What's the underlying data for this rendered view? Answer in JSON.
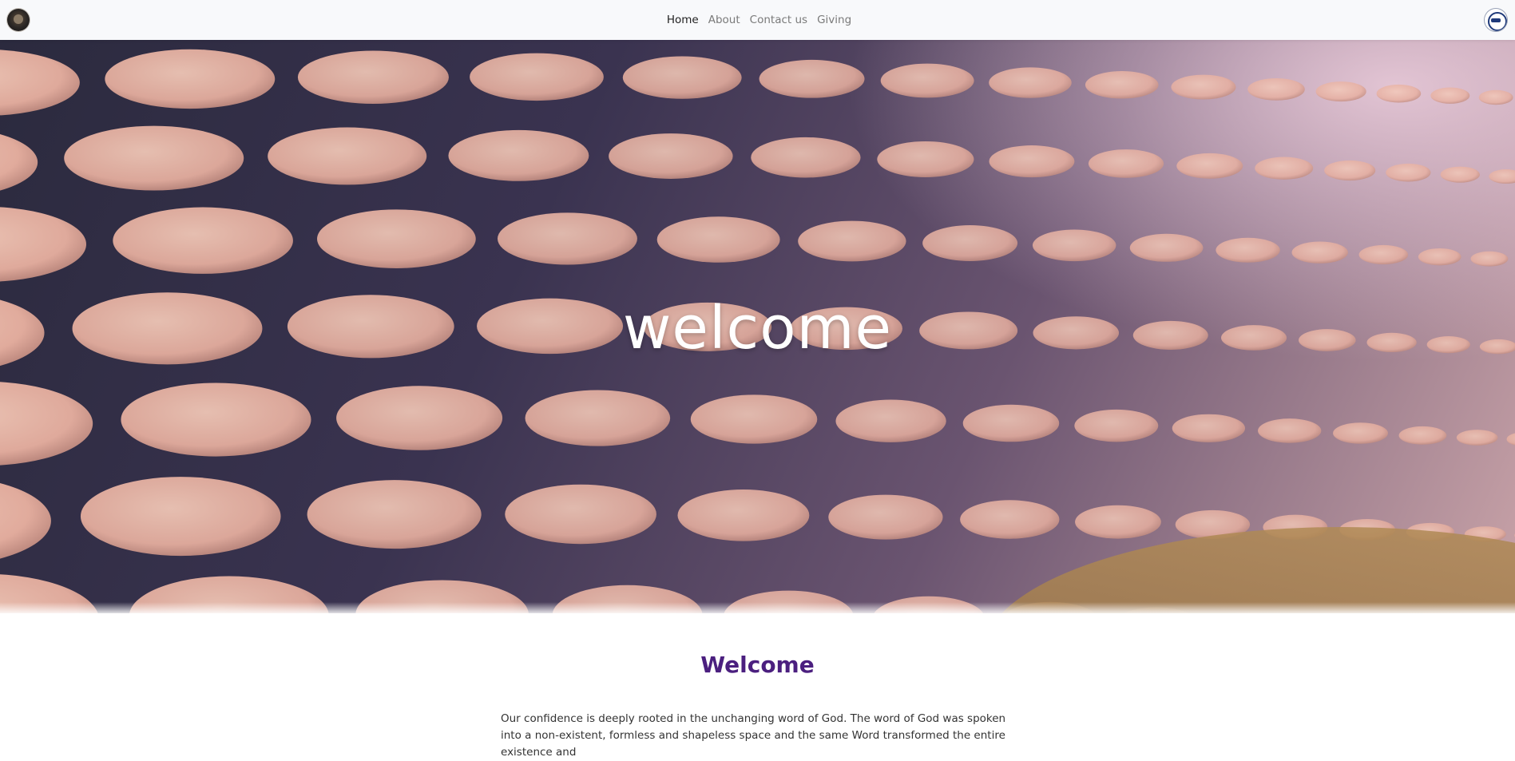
{
  "nav": {
    "links": [
      {
        "label": "Home",
        "active": true
      },
      {
        "label": "About",
        "active": false
      },
      {
        "label": "Contact us",
        "active": false
      },
      {
        "label": "Giving",
        "active": false
      }
    ]
  },
  "hero": {
    "title": "welcome"
  },
  "welcome_section": {
    "heading": "Welcome",
    "body": "Our confidence is deeply rooted in the unchanging word of God. The word of God was spoken into a non-existent, formless and shapeless space and the same Word transformed the entire existence and"
  },
  "colors": {
    "heading_purple": "#4b1f7f",
    "nav_bg": "#f8f9fb",
    "disk_fill": "#e8b0a0",
    "disk_gap": "#2e2c44"
  },
  "icons": {
    "left_logo": "church-logo-icon",
    "right_logo": "ministry-seal-icon"
  }
}
